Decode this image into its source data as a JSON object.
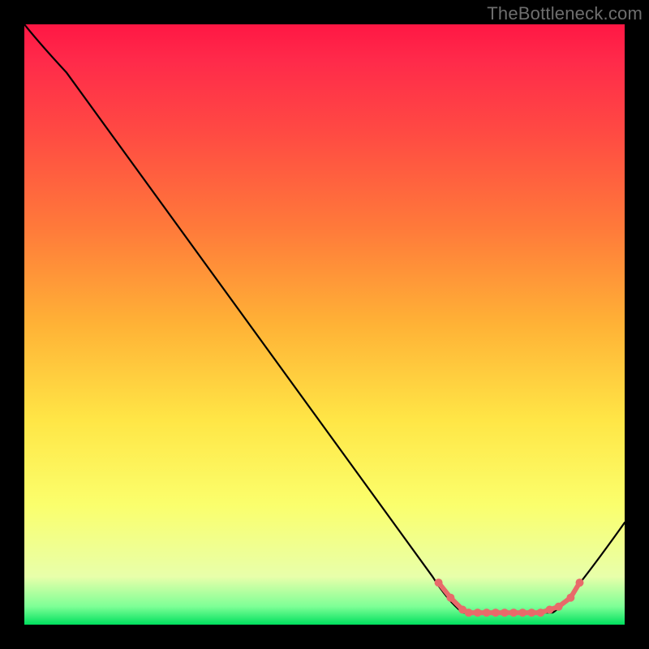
{
  "watermark": "TheBottleneck.com",
  "chart_data": {
    "type": "line",
    "title": "",
    "xlabel": "",
    "ylabel": "",
    "xlim": [
      0,
      100
    ],
    "ylim": [
      0,
      100
    ],
    "series": [
      {
        "name": "curve",
        "x": [
          0,
          7,
          68,
          73,
          88,
          100
        ],
        "y": [
          100,
          92,
          8,
          2,
          2,
          17
        ]
      }
    ],
    "marker_points": {
      "name": "dots",
      "color": "#e86a6a",
      "x": [
        69,
        71,
        73,
        74,
        75.5,
        77,
        78.5,
        80,
        81.5,
        83,
        84.5,
        86,
        87.5,
        89,
        91,
        92.5
      ],
      "y": [
        7,
        4.5,
        2.5,
        2,
        2,
        2,
        2,
        2,
        2,
        2,
        2,
        2,
        2.5,
        3,
        4.5,
        7
      ]
    },
    "gradient_stops": [
      {
        "pos": 0.0,
        "color": "#ff1744"
      },
      {
        "pos": 0.06,
        "color": "#ff2a4a"
      },
      {
        "pos": 0.18,
        "color": "#ff4a43"
      },
      {
        "pos": 0.34,
        "color": "#ff7a3a"
      },
      {
        "pos": 0.5,
        "color": "#ffb236"
      },
      {
        "pos": 0.66,
        "color": "#ffe646"
      },
      {
        "pos": 0.8,
        "color": "#fbff6c"
      },
      {
        "pos": 0.92,
        "color": "#e8ffaa"
      },
      {
        "pos": 0.97,
        "color": "#7dff96"
      },
      {
        "pos": 1.0,
        "color": "#00e05e"
      }
    ]
  }
}
